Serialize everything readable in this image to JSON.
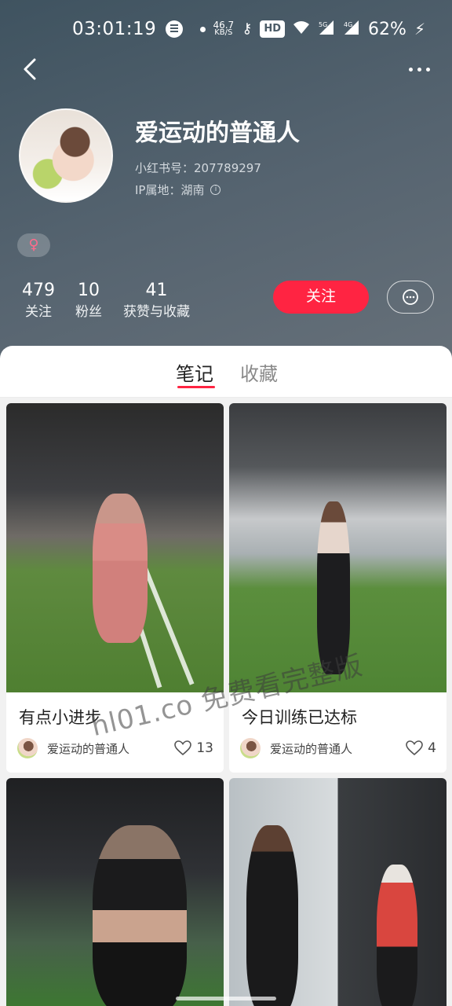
{
  "status_bar": {
    "time": "03:01:19",
    "speed_value": "46.7",
    "speed_unit": "KB/S",
    "hd": "HD",
    "net_5g": "5G",
    "net_4g": "4G",
    "battery": "62%"
  },
  "profile": {
    "name": "爱运动的普通人",
    "xhs_id": "小红书号：207789297",
    "ip_location": "IP属地：湖南",
    "gender_symbol": "♀",
    "stats": [
      {
        "num": "479",
        "label": "关注"
      },
      {
        "num": "10",
        "label": "粉丝"
      },
      {
        "num": "41",
        "label": "获赞与收藏"
      }
    ],
    "follow_label": "关注"
  },
  "tabs": [
    {
      "label": "笔记",
      "active": true
    },
    {
      "label": "收藏",
      "active": false
    }
  ],
  "notes": [
    {
      "title": "有点小进步",
      "author": "爱运动的普通人",
      "likes": "13"
    },
    {
      "title": "今日训练已达标",
      "author": "爱运动的普通人",
      "likes": "4"
    }
  ],
  "watermark": "hl01.co 免费看完整版",
  "colors": {
    "accent": "#ff2442",
    "header_bg": "#4f5e69"
  }
}
